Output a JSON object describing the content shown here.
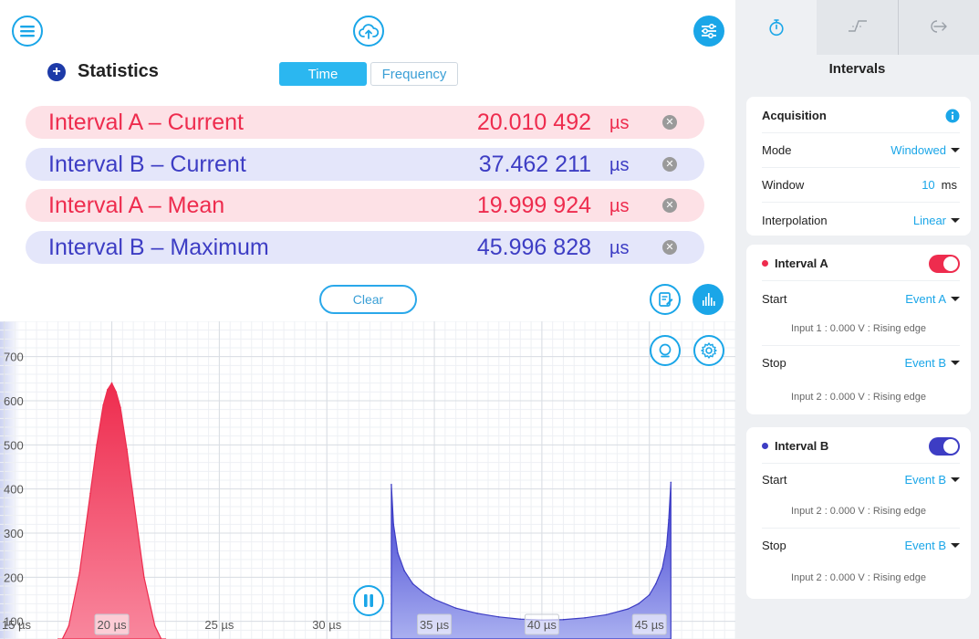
{
  "header": {
    "statistics_title": "Statistics",
    "tabs": [
      {
        "label": "Time",
        "active": true
      },
      {
        "label": "Frequency",
        "active": false
      }
    ]
  },
  "stats": [
    {
      "label": "Interval A – Current",
      "value": "20.010 492",
      "unit": "µs",
      "series": "a"
    },
    {
      "label": "Interval B – Current",
      "value": "37.462 211",
      "unit": "µs",
      "series": "b"
    },
    {
      "label": "Interval A – Mean",
      "value": "19.999 924",
      "unit": "µs",
      "series": "a"
    },
    {
      "label": "Interval B – Maximum",
      "value": "45.996 828",
      "unit": "µs",
      "series": "b"
    }
  ],
  "clear_label": "Clear",
  "icons": {
    "menu": "menu-icon",
    "upload": "cloud-upload-icon",
    "settings": "sliders-icon",
    "notes": "edit-note-icon",
    "histogram": "histogram-icon",
    "zoom": "zoom-icon",
    "chart_settings": "gear-icon",
    "pause": "pause-icon",
    "close": "close-icon"
  },
  "colors": {
    "accent": "#1aa6e8",
    "interval_a": "#ee2c4e",
    "interval_b": "#3d3dc4"
  },
  "chart_data": {
    "type": "area",
    "x_ticks": [
      "15 µs",
      "20 µs",
      "25 µs",
      "30 µs",
      "35 µs",
      "40 µs",
      "45 µs"
    ],
    "y_ticks": [
      "100",
      "200",
      "300",
      "400",
      "500",
      "600",
      "700"
    ],
    "xlim": [
      14.8,
      49
    ],
    "ylim": [
      60,
      780
    ],
    "series": [
      {
        "color": "#ee2c4e",
        "x": [
          17.5,
          18.0,
          18.5,
          19.0,
          19.3,
          19.6,
          19.8,
          20.0,
          20.2,
          20.4,
          20.7,
          21.0,
          21.5,
          22.0,
          22.5
        ],
        "y": [
          40,
          90,
          210,
          390,
          500,
          590,
          625,
          640,
          620,
          585,
          490,
          380,
          200,
          90,
          40
        ]
      },
      {
        "color": "#3d3dc4",
        "x": [
          33.0,
          33.1,
          33.3,
          33.6,
          34.0,
          34.5,
          35.0,
          36.0,
          37.0,
          38.0,
          39.0,
          40.0,
          41.0,
          42.0,
          43.0,
          44.0,
          44.5,
          45.0,
          45.3,
          45.6,
          45.8,
          45.9,
          46.0
        ],
        "y": [
          410,
          320,
          255,
          215,
          185,
          165,
          150,
          130,
          118,
          110,
          105,
          103,
          104,
          108,
          115,
          128,
          140,
          160,
          185,
          220,
          270,
          330,
          415
        ]
      }
    ]
  },
  "panel": {
    "title": "Intervals",
    "tab_icons": [
      "stopwatch-icon",
      "edge-icon",
      "output-arrow-icon"
    ],
    "acquisition": {
      "title": "Acquisition",
      "mode_label": "Mode",
      "mode_value": "Windowed",
      "window_label": "Window",
      "window_value": "10",
      "window_unit": "ms",
      "interp_label": "Interpolation",
      "interp_value": "Linear"
    },
    "interval_a": {
      "title": "Interval A",
      "enabled": true,
      "start_label": "Start",
      "start_value": "Event A",
      "start_note": "Input 1 : 0.000 V : Rising edge",
      "stop_label": "Stop",
      "stop_value": "Event B",
      "stop_note": "Input 2 : 0.000 V : Rising edge"
    },
    "interval_b": {
      "title": "Interval B",
      "enabled": true,
      "start_label": "Start",
      "start_value": "Event B",
      "start_note": "Input 2 : 0.000 V : Rising edge",
      "stop_label": "Stop",
      "stop_value": "Event B",
      "stop_note": "Input 2 : 0.000 V : Rising edge"
    }
  }
}
